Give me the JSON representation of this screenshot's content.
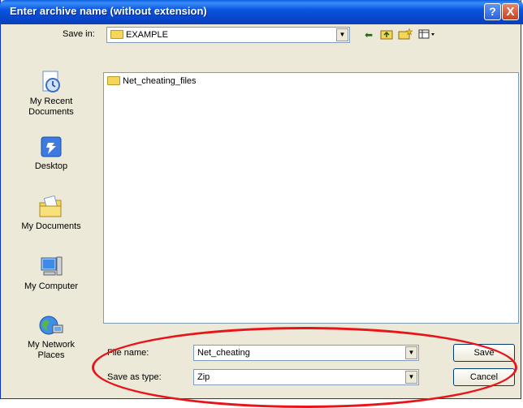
{
  "window": {
    "title": "Enter archive name (without extension)"
  },
  "titlebar_buttons": {
    "help": "?",
    "close": "X"
  },
  "save_in": {
    "label": "Save in:",
    "value": "EXAMPLE"
  },
  "places": [
    {
      "label": "My Recent\nDocuments",
      "icon": "recent-documents-icon"
    },
    {
      "label": "Desktop",
      "icon": "desktop-icon"
    },
    {
      "label": "My Documents",
      "icon": "my-documents-icon"
    },
    {
      "label": "My Computer",
      "icon": "my-computer-icon"
    },
    {
      "label": "My Network\nPlaces",
      "icon": "network-places-icon"
    }
  ],
  "files": [
    {
      "name": "Net_cheating_files",
      "type": "folder"
    }
  ],
  "file_name": {
    "label": "File name:",
    "value": "Net_cheating"
  },
  "save_as_type": {
    "label": "Save as type:",
    "value": "Zip"
  },
  "buttons": {
    "save": "Save",
    "cancel": "Cancel"
  },
  "colors": {
    "title_bar": "#0a54e0",
    "annotation_ellipse": "#e8141a",
    "dialog_bg": "#ece9d8"
  }
}
